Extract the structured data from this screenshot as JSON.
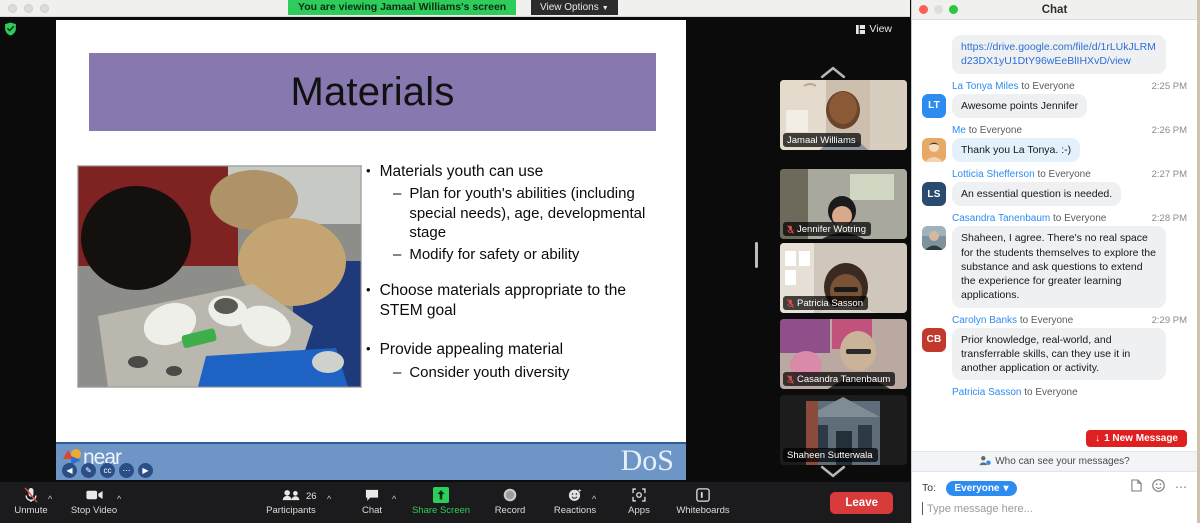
{
  "banner": {
    "viewing_text": "You are viewing Jamaal Williams's screen",
    "view_options_label": "View Options",
    "chevron": "chevron-down"
  },
  "stage": {
    "view_button_label": "View",
    "security_icon": "shield-check-icon"
  },
  "slide": {
    "title": "Materials",
    "photo_alt": "children in gloves examining materials on a tray",
    "bullets": [
      {
        "level": 1,
        "text": "Materials youth can use"
      },
      {
        "level": 2,
        "text": "Plan for youth's abilities (including special needs), age, developmental stage"
      },
      {
        "level": 2,
        "text": "Modify for safety or ability"
      },
      {
        "level": 0,
        "text": ""
      },
      {
        "level": 1,
        "text": "Choose materials appropriate to the STEM goal"
      },
      {
        "level": 0,
        "text": ""
      },
      {
        "level": 1,
        "text": "Provide appealing material"
      },
      {
        "level": 2,
        "text": "Consider youth diversity"
      }
    ],
    "footer": {
      "left_logo": "near",
      "right_logo": "DoS",
      "nav_icons": [
        "previous-slide",
        "pen-tool",
        "captions",
        "more-options",
        "next-slide"
      ]
    },
    "accent_color": "#8878b0",
    "footer_color": "#6d96c7"
  },
  "filmstrip": {
    "scroll_up_icon": "chevron-up-icon",
    "scroll_down_icon": "chevron-down-icon",
    "tiles": [
      {
        "name": "Jamaal Williams",
        "active": true,
        "muted": false
      },
      {
        "name": "Jennifer Wotring",
        "active": false,
        "muted": true
      },
      {
        "name": "Patricia Sasson",
        "active": false,
        "muted": true
      },
      {
        "name": "Casandra Tanenbaum",
        "active": false,
        "muted": true
      },
      {
        "name": "Shaheen Sutterwala",
        "active": false,
        "muted": false
      }
    ]
  },
  "toolbar": {
    "items": [
      {
        "label": "Unmute",
        "icon": "microphone-muted-icon",
        "caret": true,
        "highlight": false
      },
      {
        "label": "Stop Video",
        "icon": "video-camera-icon",
        "caret": true,
        "highlight": false
      },
      {
        "label": "Participants",
        "icon": "participants-icon",
        "caret": true,
        "highlight": false,
        "count": "26"
      },
      {
        "label": "Chat",
        "icon": "chat-bubble-icon",
        "caret": true,
        "highlight": false
      },
      {
        "label": "Share Screen",
        "icon": "share-screen-icon",
        "caret": false,
        "highlight": true
      },
      {
        "label": "Record",
        "icon": "record-icon",
        "caret": false,
        "highlight": false
      },
      {
        "label": "Reactions",
        "icon": "reactions-icon",
        "caret": true,
        "highlight": false
      },
      {
        "label": "Apps",
        "icon": "apps-icon",
        "caret": false,
        "highlight": false
      },
      {
        "label": "Whiteboards",
        "icon": "whiteboard-icon",
        "caret": false,
        "highlight": false
      }
    ],
    "leave_label": "Leave",
    "share_color": "#2ecc5a",
    "leave_color": "#d93b3b"
  },
  "chat": {
    "window_title": "Chat",
    "messages": [
      {
        "id": 0,
        "truncated": true,
        "sender": "",
        "to": "",
        "time": "",
        "text": "",
        "avatar": {
          "type": "none",
          "initials": "",
          "color": ""
        },
        "style": "other"
      },
      {
        "id": 1,
        "truncated": false,
        "sender": "",
        "to": "",
        "time": "",
        "text": "https://drive.google.com/file/d/1rLUkJLRMd23DX1yU1DtY96wEeBlIHXvD/view",
        "avatar": {
          "type": "none",
          "initials": "",
          "color": ""
        },
        "style": "link"
      },
      {
        "id": 2,
        "truncated": false,
        "sender": "La Tonya Miles",
        "to": "to Everyone",
        "time": "2:25 PM",
        "text": "Awesome points Jennifer",
        "avatar": {
          "type": "initials",
          "initials": "LT",
          "color": "#2d8cf0"
        },
        "style": "other"
      },
      {
        "id": 3,
        "truncated": false,
        "sender": "Me",
        "to": "to Everyone",
        "time": "2:26 PM",
        "text": "Thank you La Tonya. :-)",
        "avatar": {
          "type": "photo",
          "initials": "",
          "color": "#e3a76a"
        },
        "style": "me"
      },
      {
        "id": 4,
        "truncated": false,
        "sender": "Lotticia Shefferson",
        "to": "to Everyone",
        "time": "2:27 PM",
        "text": "An essential question is needed.",
        "avatar": {
          "type": "initials",
          "initials": "LS",
          "color": "#2b4a6f"
        },
        "style": "other"
      },
      {
        "id": 5,
        "truncated": false,
        "sender": "Casandra Tanenbaum",
        "to": "to Everyone",
        "time": "2:28 PM",
        "text": "Shaheen, I agree.  There's no real space for the students themselves to explore the substance and ask questions to extend the experience for greater learning applications.",
        "avatar": {
          "type": "photo",
          "initials": "",
          "color": "#6b7f8c"
        },
        "style": "other"
      },
      {
        "id": 6,
        "truncated": false,
        "sender": "Carolyn Banks",
        "to": "to Everyone",
        "time": "2:29 PM",
        "text": "Prior knowledge, real-world,  and transferrable skills, can they use it in another application or activity.",
        "avatar": {
          "type": "initials",
          "initials": "CB",
          "color": "#c0392b"
        },
        "style": "other"
      },
      {
        "id": 7,
        "truncated": true,
        "sender": "Patricia Sasson",
        "to": "to Everyone",
        "time": "",
        "text": "",
        "avatar": {
          "type": "photo",
          "initials": "",
          "color": "#8a8a8a"
        },
        "style": "other"
      }
    ],
    "new_message_badge": "1 New Message",
    "new_message_arrow": "↓",
    "privacy_note": "Who can see your messages?",
    "privacy_icon": "person-add-icon",
    "compose": {
      "to_label": "To:",
      "recipient": "Everyone",
      "recipient_caret": "▾",
      "placeholder": "Type message here...",
      "icons": [
        "file-attach-icon",
        "emoji-icon",
        "more-options-icon"
      ]
    }
  }
}
